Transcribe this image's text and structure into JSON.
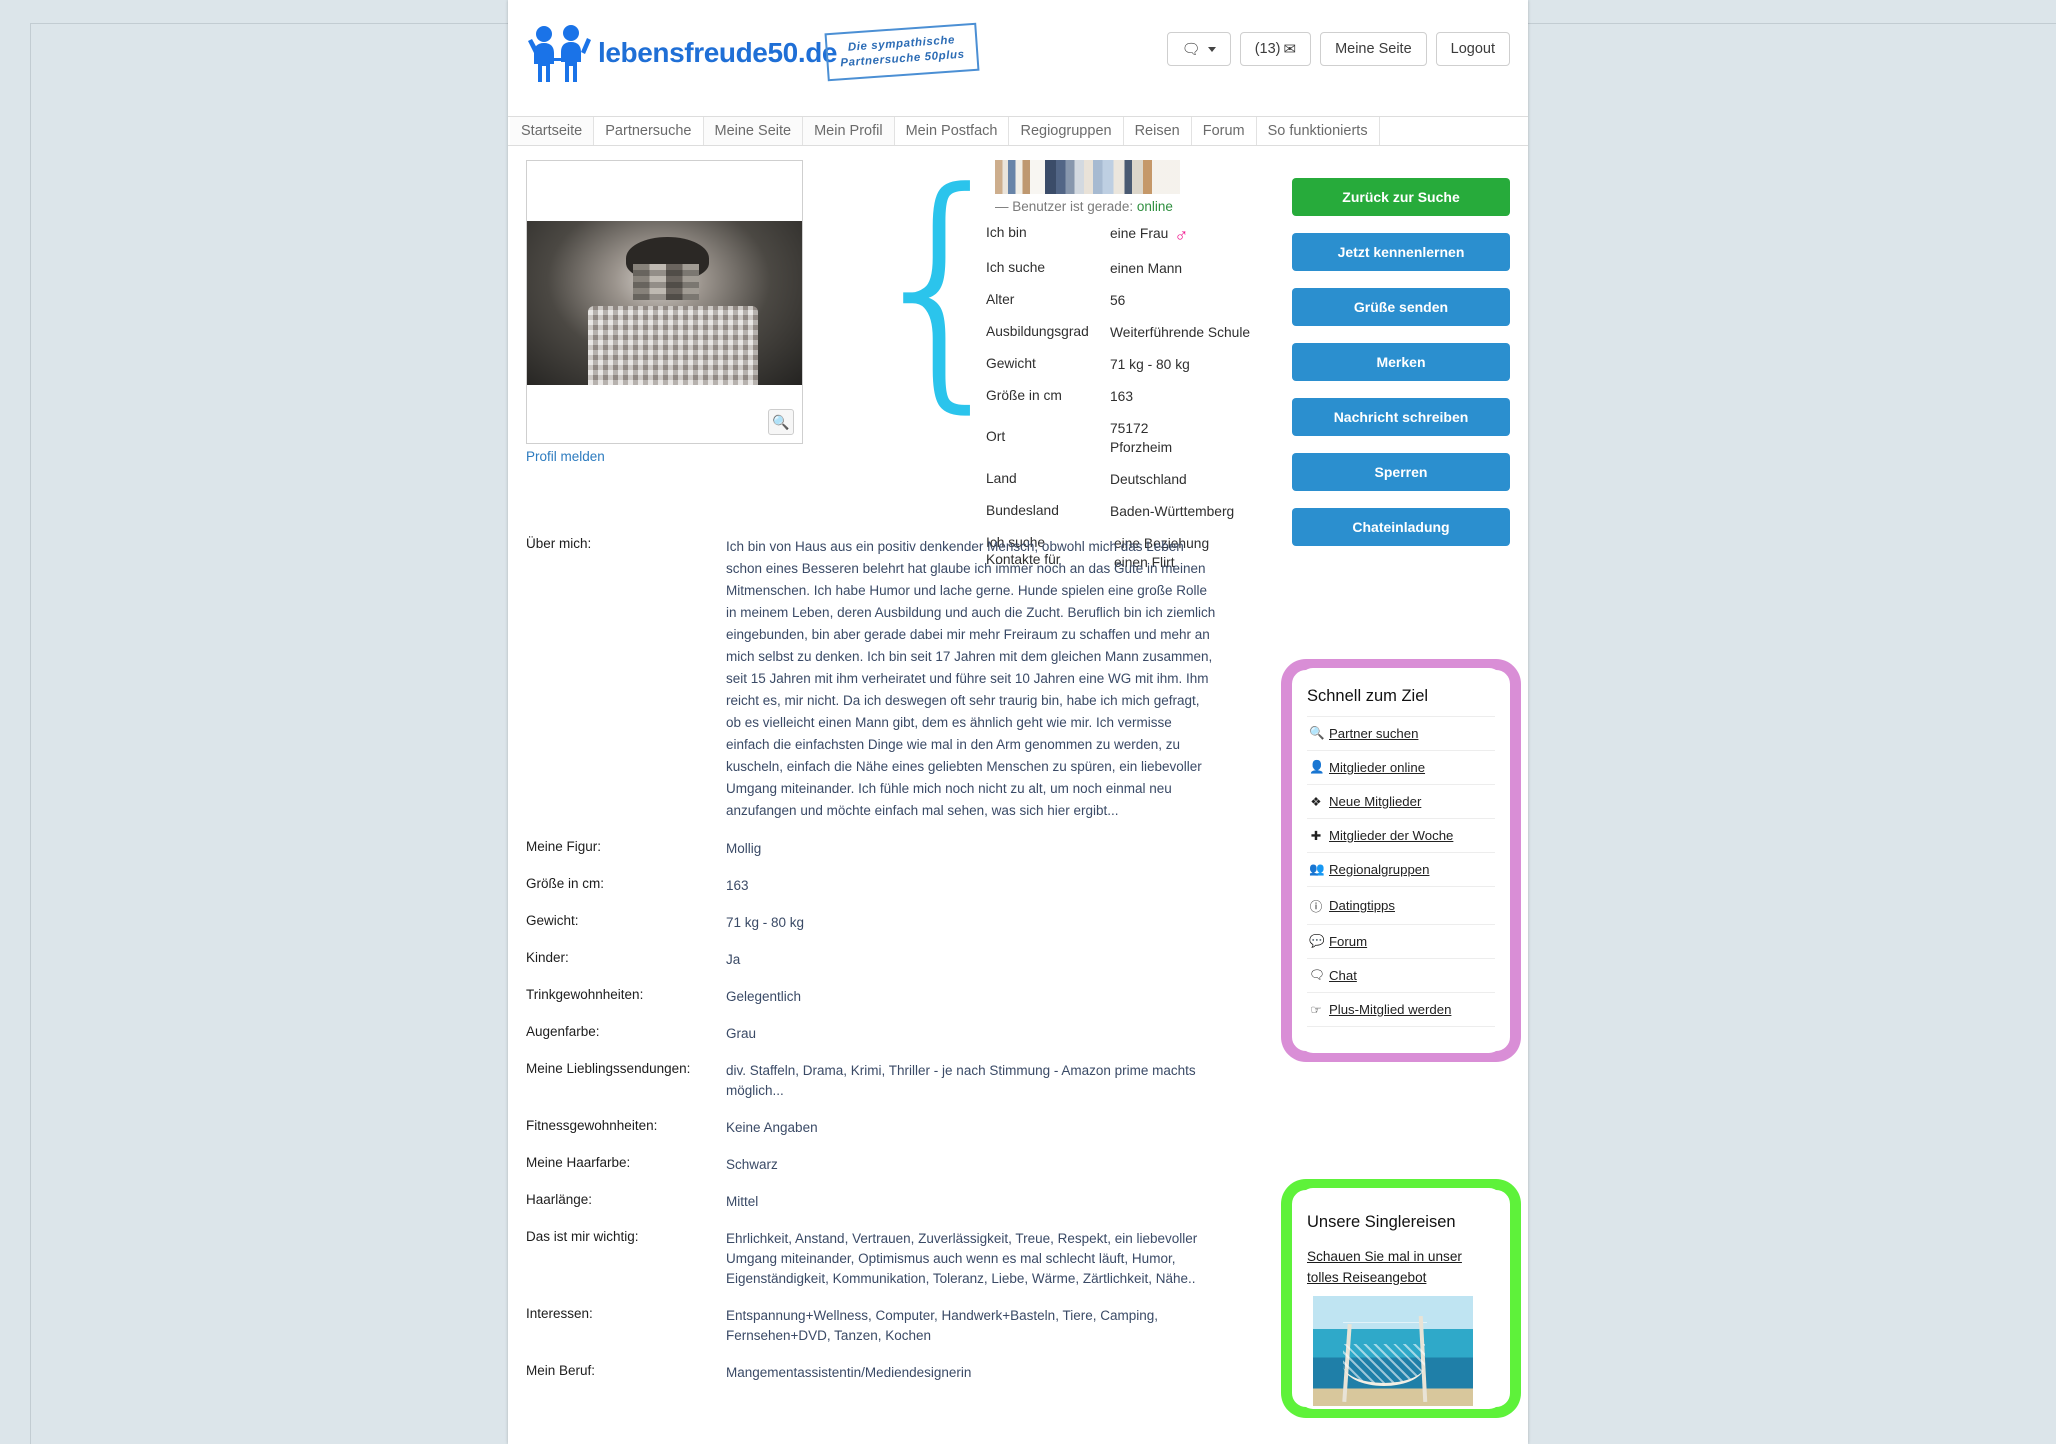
{
  "site": {
    "logo_text": "lebensfreude50.de",
    "tagline_line1": "Die sympathische",
    "tagline_line2": "Partnersuche 50plus"
  },
  "header_actions": {
    "chat_icon": "chat-bubbles-icon",
    "messages_label": "(13)",
    "messages_icon": "envelope-icon",
    "my_page_label": "Meine Seite",
    "logout_label": "Logout"
  },
  "nav": {
    "items": [
      "Startseite",
      "Partnersuche",
      "Meine Seite",
      "Mein Profil",
      "Mein Postfach",
      "Regiogruppen",
      "Reisen",
      "Forum",
      "So funktionierts"
    ]
  },
  "photo": {
    "zoom_icon": "magnifier-plus-icon",
    "report_link": "Profil melden"
  },
  "profile": {
    "username": "",
    "status_prefix": "— Benutzer ist gerade:",
    "status_value": "online",
    "brace_glyph": "{",
    "gender_icon": "female-figure-icon",
    "attributes": [
      {
        "label": "Ich bin",
        "value": "eine Frau",
        "icon": "female-figure-icon"
      },
      {
        "label": "Ich suche",
        "value": "einen Mann"
      },
      {
        "label": "Alter",
        "value": "56"
      },
      {
        "label": "Ausbildungsgrad",
        "value": "Weiterführende Schule"
      },
      {
        "label": "Gewicht",
        "value": "71 kg - 80 kg"
      },
      {
        "label": "Größe in cm",
        "value": "163"
      },
      {
        "label": "Ort",
        "value": "75172\nPforzheim"
      },
      {
        "label": "Land",
        "value": "Deutschland"
      },
      {
        "label": "Bundesland",
        "value": "Baden-Württemberg"
      },
      {
        "label": "Ich suche\nKontakte für",
        "value": "eine Beziehung\neinen Flirt"
      }
    ]
  },
  "actions": {
    "buttons": [
      {
        "label": "Zurück zur Suche",
        "color": "#27ab3b"
      },
      {
        "label": "Jetzt kennenlernen",
        "color": "#2b8fcf"
      },
      {
        "label": "Grüße senden",
        "color": "#2b8fcf"
      },
      {
        "label": "Merken",
        "color": "#2b8fcf"
      },
      {
        "label": "Nachricht schreiben",
        "color": "#2b8fcf"
      },
      {
        "label": "Sperren",
        "color": "#2b8fcf"
      },
      {
        "label": "Chateinladung",
        "color": "#2b8fcf"
      }
    ]
  },
  "details": {
    "rows": [
      {
        "label": "Über mich:",
        "value": "Ich bin von Haus aus ein positiv denkender Mensch, obwohl mich das Leben schon eines Besseren belehrt hat glaube ich immer noch an das Gute in meinen Mitmenschen. Ich habe Humor und lache gerne. Hunde spielen eine große Rolle in meinem Leben, deren Ausbildung und auch die Zucht. Beruflich bin ich ziemlich eingebunden, bin aber gerade dabei mir mehr Freiraum zu schaffen und mehr an mich selbst zu denken. Ich bin seit 17 Jahren mit dem gleichen Mann zusammen, seit 15 Jahren mit ihm verheiratet und führe seit 10 Jahren eine WG mit ihm. Ihm reicht es, mir nicht. Da ich deswegen oft sehr traurig bin, habe ich mich gefragt, ob es vielleicht einen Mann gibt, dem es ähnlich geht wie mir. Ich vermisse einfach die einfachsten Dinge wie mal in den Arm genommen zu werden, zu kuscheln, einfach die Nähe eines geliebten Menschen zu spüren, ein liebevoller Umgang miteinander. Ich fühle mich noch nicht zu alt, um noch einmal neu anzufangen und möchte einfach mal sehen, was sich hier ergibt..."
      },
      {
        "label": "Meine Figur:",
        "value": "Mollig"
      },
      {
        "label": "Größe in cm:",
        "value": "163"
      },
      {
        "label": "Gewicht:",
        "value": "71 kg - 80 kg"
      },
      {
        "label": "Kinder:",
        "value": "Ja"
      },
      {
        "label": "Trinkgewohnheiten:",
        "value": "Gelegentlich"
      },
      {
        "label": "Augenfarbe:",
        "value": "Grau"
      },
      {
        "label": "Meine Lieblingssendungen:",
        "value": "div. Staffeln, Drama, Krimi, Thriller - je nach Stimmung - Amazon prime machts möglich..."
      },
      {
        "label": "Fitnessgewohnheiten:",
        "value": "Keine Angaben"
      },
      {
        "label": "Meine Haarfarbe:",
        "value": "Schwarz"
      },
      {
        "label": "Haarlänge:",
        "value": "Mittel"
      },
      {
        "label": "Das ist mir wichtig:",
        "value": "Ehrlichkeit, Anstand, Vertrauen, Zuverlässigkeit, Treue, Respekt, ein liebevoller Umgang miteinander, Optimismus auch wenn es mal schlecht läuft, Humor, Eigenständigkeit, Kommunikation, Toleranz, Liebe, Wärme, Zärtlichkeit, Nähe.."
      },
      {
        "label": "Interessen:",
        "value": "Entspannung+Wellness, Computer, Handwerk+Basteln, Tiere, Camping, Fernsehen+DVD, Tanzen, Kochen"
      },
      {
        "label": "Mein Beruf:",
        "value": "Mangementassistentin/Mediendesignerin"
      }
    ]
  },
  "quick_widget": {
    "title": "Schnell zum Ziel",
    "accent_color": "#d98ed6",
    "items": [
      {
        "label": "Partner suchen",
        "icon": "search-icon",
        "glyph": "🔍"
      },
      {
        "label": "Mitglieder online",
        "icon": "user-icon",
        "glyph": "👤"
      },
      {
        "label": "Neue Mitglieder",
        "icon": "flame-icon",
        "glyph": "🔥"
      },
      {
        "label": "Mitglieder der Woche",
        "icon": "plus-icon",
        "glyph": "✚"
      },
      {
        "label": "Regionalgruppen",
        "icon": "group-icon",
        "glyph": "👥"
      },
      {
        "label": "Datingtipps",
        "icon": "info-icon",
        "glyph": "ℹ"
      },
      {
        "label": "Forum",
        "icon": "speech-bubble-icon",
        "glyph": "💬"
      },
      {
        "label": "Chat",
        "icon": "chat-bubbles-icon",
        "glyph": "🗨"
      },
      {
        "label": "Plus-Mitglied werden",
        "icon": "hand-pointer-icon",
        "glyph": "☝"
      }
    ]
  },
  "travel_widget": {
    "title": "Unsere Singlereisen",
    "accent_color": "#5ef23a",
    "link_line1": "Schauen Sie mal in unser",
    "link_line2": "tolles Reiseangebot",
    "image_alt": "hammock-beach-photo"
  }
}
